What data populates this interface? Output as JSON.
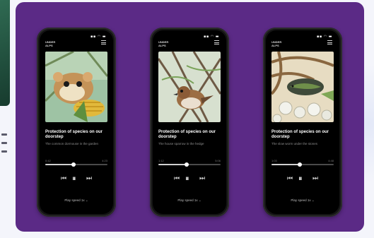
{
  "panel": {
    "bg": "#5b2a86"
  },
  "phones": [
    {
      "status": "▪▪ ◠ ▬",
      "brand_line1": "UNDER",
      "brand_line2": "ALPS",
      "title": "Protection of species on our doorstep",
      "subtitle": "The common dormouse in the garden",
      "time_start": "0:42",
      "time_end": "4:23",
      "progress": 0.45,
      "speed_label": "Play speed 1x",
      "art": "dormouse-with-corn"
    },
    {
      "status": "▪▪ ◠ ▬",
      "brand_line1": "UNDER",
      "brand_line2": "ALPS",
      "title": "Protection of species on our doorstep",
      "subtitle": "The house sparrow in the hedge",
      "time_start": "1:12",
      "time_end": "5:06",
      "progress": 0.45,
      "speed_label": "Play speed 1x",
      "art": "sparrow-in-branches"
    },
    {
      "status": "▪▪ ◠ ▬",
      "brand_line1": "UNDER",
      "brand_line2": "ALPS",
      "title": "Protection of species on our doorstep",
      "subtitle": "The slow worm under the stones",
      "time_start": "1:03",
      "time_end": "4:48",
      "progress": 0.45,
      "speed_label": "Play speed 1x",
      "art": "lizard-under-stones"
    }
  ],
  "icons": {
    "prev": "⏮",
    "pause": "⏸",
    "next": "⏭",
    "chevron": "⌄"
  }
}
